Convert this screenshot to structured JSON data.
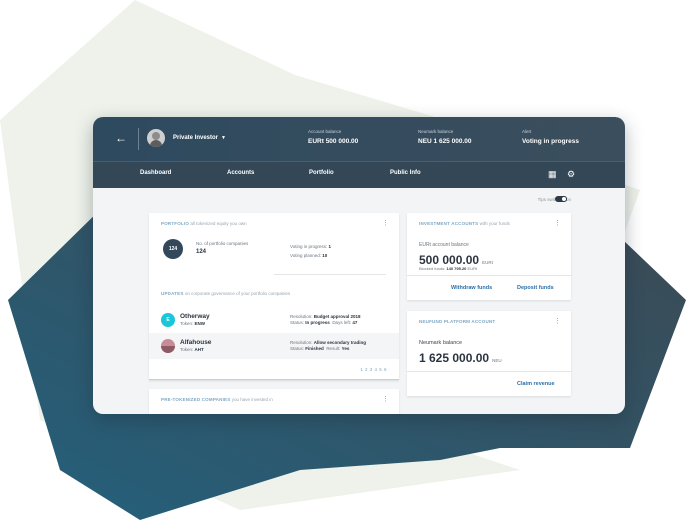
{
  "header": {
    "back_icon": "arrow-left-icon",
    "role": "Private Investor",
    "account_balance_label": "Account balance",
    "account_balance_value": "EURt 500 000.00",
    "neumark_balance_label": "Neumark balance",
    "neumark_balance_value": "NEU 1 625 000.00",
    "alert_label": "Alert",
    "alert_value": "Voting in progress"
  },
  "nav": {
    "items": [
      "Dashboard",
      "Accounts",
      "Portfolio",
      "Public Info"
    ],
    "grid_icon": "grid-icon",
    "settings_icon": "gear-icon"
  },
  "tips": {
    "label": "Tips switched on",
    "enabled": true
  },
  "portfolio": {
    "title": "PORTFOLIO",
    "subtitle": "all tokenized equity you own",
    "count": "124",
    "companies_label": "No. of portfolio companies",
    "companies_value": "124",
    "voting_in_progress_label": "Voting in progress:",
    "voting_in_progress_value": "1",
    "voting_planned_label": "Voting planned:",
    "voting_planned_value": "10"
  },
  "updates": {
    "title": "UPDATES",
    "subtitle": "on corporate governance of your portfolio companies",
    "rows": [
      {
        "icon_letter": "E",
        "name": "Otherway",
        "token_label": "Token:",
        "token": "ENW",
        "resolution_label": "Resolution:",
        "resolution": "Budget approval 2018",
        "status_label": "Status:",
        "status": "In progress",
        "extra_label": "Days left:",
        "extra": "47"
      },
      {
        "icon_letter": "",
        "name": "Alfahouse",
        "token_label": "Token:",
        "token": "AHT",
        "resolution_label": "Resolution:",
        "resolution": "Allow secondary trading",
        "status_label": "Status:",
        "status": "Finished",
        "extra_label": "Result:",
        "extra": "Yes"
      }
    ],
    "pager": "1 2 3 4 5 6"
  },
  "pretokenized": {
    "title": "PRE-TOKENIZED COMPANIES",
    "subtitle": "you have invested in"
  },
  "investment": {
    "title": "INVESTMENT ACCOUNTS",
    "subtitle": "with your funds",
    "balance_label": "EURt account balance",
    "balance_value": "500 000.00",
    "balance_unit": "EURt",
    "blocked_label": "Blocked funds:",
    "blocked_value": "140 795.20",
    "blocked_unit": "EURt",
    "withdraw": "Withdraw funds",
    "deposit": "Deposit funds"
  },
  "neufund": {
    "title": "NEUFUND PLATFORM ACCOUNT",
    "balance_label": "Neumark balance",
    "balance_value": "1 625 000.00",
    "balance_unit": "NEU",
    "claim": "Claim revenue"
  },
  "colors": {
    "header": "#2e4a5f",
    "accent_link": "#2b6fa8",
    "teal_icon": "#19c7d8",
    "shape_dark": "#2d5569",
    "shape_light": "#eef2ea"
  }
}
